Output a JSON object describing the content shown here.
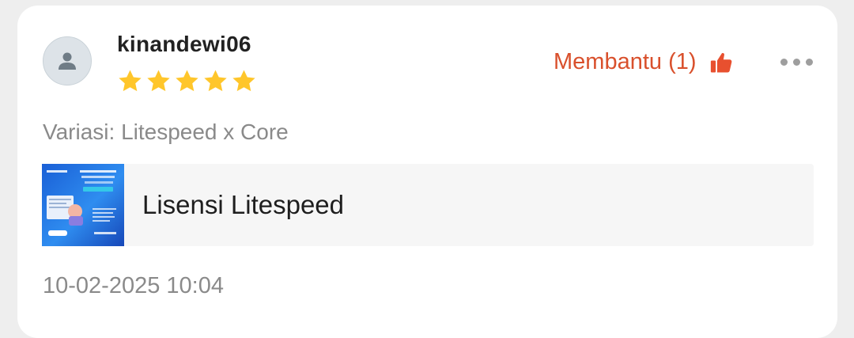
{
  "review": {
    "username": "kinandewi06",
    "rating": 5,
    "rating_max": 5,
    "helpful_label": "Membantu (1)",
    "variation": "Variasi: Litespeed x Core",
    "product_name": "Lisensi Litespeed",
    "datetime": "10-02-2025 10:04"
  },
  "icons": {
    "avatar": "user-avatar-icon",
    "star": "star-icon",
    "helpful": "thumbs-up-icon",
    "more": "more-options-icon"
  },
  "colors": {
    "accent": "#d9502c",
    "star": "#ffc62b",
    "muted_text": "#8a8a8a"
  }
}
